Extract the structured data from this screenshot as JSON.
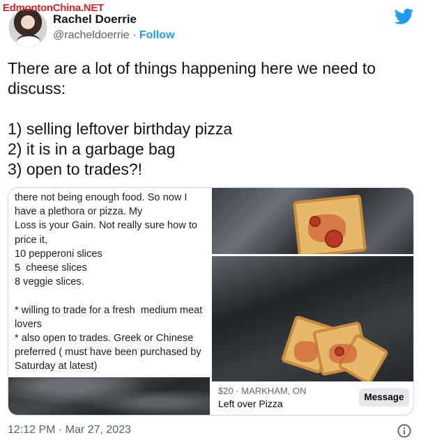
{
  "watermark": "EdmontonChina.NET",
  "author": {
    "name": "Rachel Doerrie",
    "handle": "@racheldoerrie",
    "separator": " · ",
    "follow_label": "Follow"
  },
  "brand": {
    "icon": "twitter-bird-icon",
    "color": "#1d9bf0"
  },
  "tweet": {
    "text": "There are a lot of things happening here we need to discuss:\n\n1) selling leftover birthday pizza\n2) it is in a garbage bag\n3) open to trades?!"
  },
  "media": {
    "listing_text": "there not being enough food. So now I have a plethora or pizza. My\nLoss is your Gain. Not really sure how to price it,\n10 pepperoni slices\n5  cheese slices\n8 veggie slices.\n\n* willing to trade for a fresh  medium meat lovers\n* also open to trades. Greek or Chinese preferred ( must have been purchased by Saturday at latest)",
    "marketplace": {
      "price_location": "$20 · MARKHAM, ON",
      "title": "Left over Pizza",
      "message_label": "Message"
    }
  },
  "timestamp": "12:12 PM · Mar 27, 2023",
  "info_icon": "info-icon"
}
